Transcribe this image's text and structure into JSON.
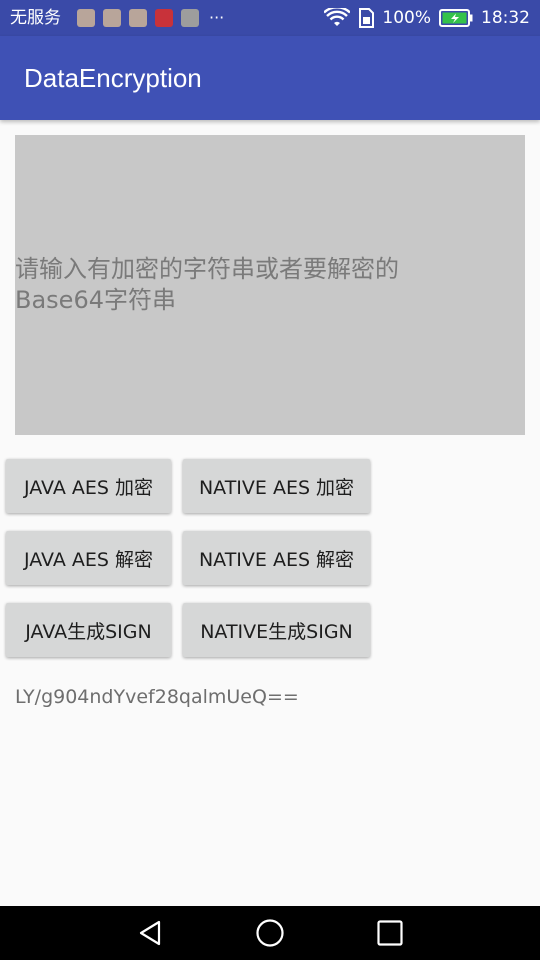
{
  "status_bar": {
    "carrier": "无服务",
    "more": "···",
    "battery_percent": "100%",
    "time": "18:32",
    "notification_icons": [
      "app-icon",
      "app-icon",
      "app-icon",
      "netease-icon",
      "app-icon"
    ]
  },
  "app_bar": {
    "title": "DataEncryption"
  },
  "input": {
    "placeholder": "请输入有加密的字符串或者要解密的Base64字符串",
    "value": ""
  },
  "buttons": {
    "java_aes_encrypt": "JAVA AES 加密",
    "native_aes_encrypt": "NATIVE AES 加密",
    "java_aes_decrypt": "JAVA AES 解密",
    "native_aes_decrypt": "NATIVE AES 解密",
    "java_sign": "JAVA生成SIGN",
    "native_sign": "NATIVE生成SIGN"
  },
  "result": {
    "text": "LY/g904ndYvef28qalmUeQ=="
  },
  "colors": {
    "primary": "#3f51b5",
    "primary_dark": "#3a4aa8",
    "input_bg": "#c8c8c8",
    "button_bg": "#d6d7d7",
    "background": "#fafafa"
  }
}
